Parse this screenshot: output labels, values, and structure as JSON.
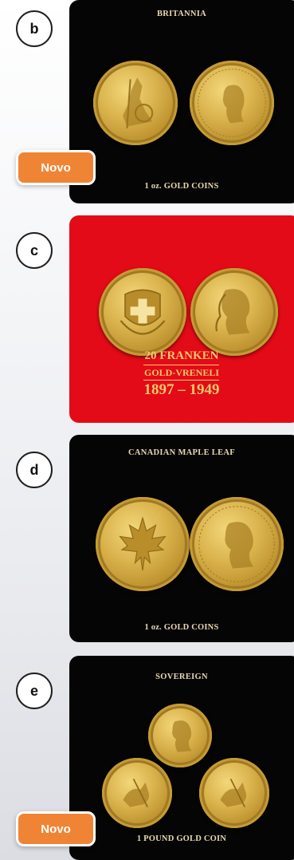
{
  "items": [
    {
      "letter": "b",
      "title": "BRITANNIA",
      "footer": "1 oz. GOLD COINS",
      "badge": "Novo"
    },
    {
      "letter": "c",
      "title_line1": "20 FRANKEN",
      "title_line2": "GOLD-VRENELI",
      "title_line3": "1897 – 1949"
    },
    {
      "letter": "d",
      "title": "CANADIAN MAPLE LEAF",
      "footer": "1 oz. GOLD COINS"
    },
    {
      "letter": "e",
      "title": "SOVEREIGN",
      "footer": "1 POUND GOLD COIN",
      "badge": "Novo"
    }
  ],
  "colors": {
    "badge_orange": "#f08435",
    "card_black": "#050505",
    "card_red": "#e30b17",
    "gold_text": "#e8d9b0"
  }
}
